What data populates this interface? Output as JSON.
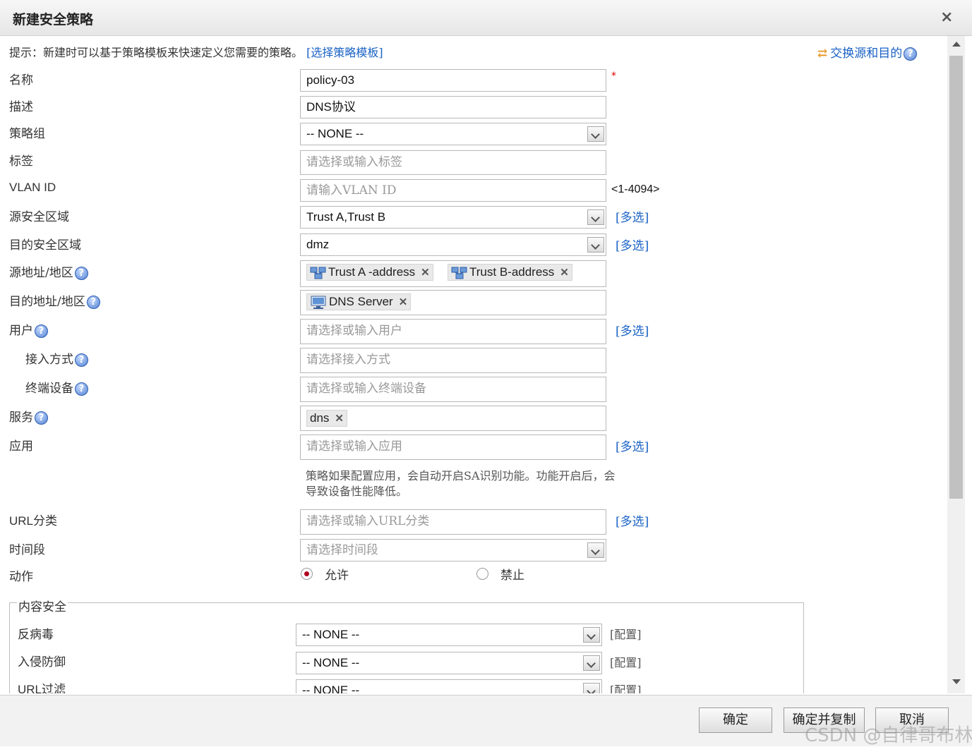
{
  "dialog": {
    "title": "新建安全策略",
    "close": "×"
  },
  "hint": {
    "text": "提示：新建时可以基于策略模板来快速定义您需要的策略。",
    "link": "[选择策略模板]"
  },
  "swap": {
    "icon": "swap-arrows-icon",
    "label": "交换源和目的"
  },
  "help_glyph": "?",
  "multi_label": "[多选]",
  "fields": {
    "name": {
      "label": "名称",
      "value": "policy-03",
      "required": "*"
    },
    "desc": {
      "label": "描述",
      "value": "DNS协议"
    },
    "group": {
      "label": "策略组",
      "value": "-- NONE --"
    },
    "tag": {
      "label": "标签",
      "placeholder": "请选择或输入标签"
    },
    "vlan": {
      "label": "VLAN ID",
      "placeholder": "请输入VLAN ID",
      "range": "<1-4094>"
    },
    "src_zone": {
      "label": "源安全区域",
      "value": "Trust A,Trust B"
    },
    "dst_zone": {
      "label": "目的安全区域",
      "value": "dmz"
    },
    "src_addr": {
      "label": "源地址/地区",
      "tags": [
        "Trust A -address",
        "Trust B-address"
      ]
    },
    "dst_addr": {
      "label": "目的地址/地区",
      "tags": [
        "DNS Server"
      ]
    },
    "user": {
      "label": "用户",
      "placeholder": "请选择或输入用户"
    },
    "access": {
      "label": "接入方式",
      "placeholder": "请选择接入方式"
    },
    "device": {
      "label": "终端设备",
      "placeholder": "请选择或输入终端设备"
    },
    "service": {
      "label": "服务",
      "tags": [
        "dns"
      ]
    },
    "app": {
      "label": "应用",
      "placeholder": "请选择或输入应用",
      "note": "策略如果配置应用，会自动开启SA识别功能。功能开启后，会导致设备性能降低。"
    },
    "url_cat": {
      "label": "URL分类",
      "placeholder": "请选择或输入URL分类"
    },
    "time": {
      "label": "时间段",
      "placeholder": "请选择时间段"
    },
    "action": {
      "label": "动作",
      "allow": "允许",
      "deny": "禁止",
      "selected": "允许"
    }
  },
  "content_security": {
    "legend": "内容安全",
    "config_label": "[配置]",
    "rows": [
      {
        "label": "反病毒",
        "value": "-- NONE --"
      },
      {
        "label": "入侵防御",
        "value": "-- NONE --"
      },
      {
        "label": "URL过滤",
        "value": "-- NONE --"
      }
    ]
  },
  "buttons": {
    "ok": "确定",
    "ok_copy": "确定并复制",
    "cancel": "取消"
  },
  "watermark": "CSDN @自律哥布林",
  "colors": {
    "link": "#1a62c5",
    "required": "#dd0000",
    "radio_selected": "#b00020"
  }
}
